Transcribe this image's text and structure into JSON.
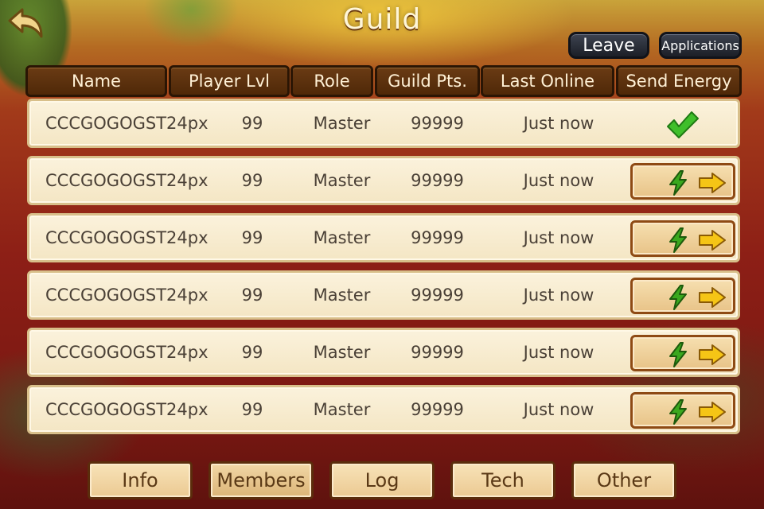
{
  "title": "Guild",
  "buttons": {
    "leave": "Leave",
    "applications": "Applications"
  },
  "columns": [
    "Name",
    "Player Lvl",
    "Role",
    "Guild Pts.",
    "Last Online",
    "Send Energy"
  ],
  "members": [
    {
      "name": "CCCGOGOGST24px",
      "level": "99",
      "role": "Master",
      "points": "99999",
      "last_online": "Just now",
      "energy_sent": true
    },
    {
      "name": "CCCGOGOGST24px",
      "level": "99",
      "role": "Master",
      "points": "99999",
      "last_online": "Just now",
      "energy_sent": false
    },
    {
      "name": "CCCGOGOGST24px",
      "level": "99",
      "role": "Master",
      "points": "99999",
      "last_online": "Just now",
      "energy_sent": false
    },
    {
      "name": "CCCGOGOGST24px",
      "level": "99",
      "role": "Master",
      "points": "99999",
      "last_online": "Just now",
      "energy_sent": false
    },
    {
      "name": "CCCGOGOGST24px",
      "level": "99",
      "role": "Master",
      "points": "99999",
      "last_online": "Just now",
      "energy_sent": false
    },
    {
      "name": "CCCGOGOGST24px",
      "level": "99",
      "role": "Master",
      "points": "99999",
      "last_online": "Just now",
      "energy_sent": false
    }
  ],
  "tabs": [
    "Info",
    "Members",
    "Log",
    "Tech",
    "Other"
  ],
  "active_tab": "Members",
  "icons": {
    "back": "back-arrow-icon",
    "sent": "checkmark-icon",
    "send_energy": "lightning-bolt-icon",
    "send_arrow": "arrow-right-icon"
  },
  "colors": {
    "header": "#5a2f0e",
    "row": "#f8ecd2",
    "check": "#3fbf2a",
    "bolt": "#3aa81e",
    "arrow": "#f5c516"
  }
}
